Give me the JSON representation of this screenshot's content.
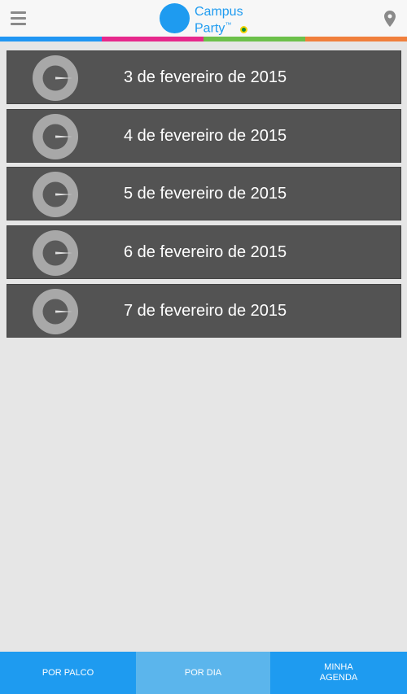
{
  "header": {
    "logo_line1": "Campus",
    "logo_line2": "Party",
    "logo_tm": "™",
    "menu_icon": "hamburger-menu-icon",
    "location_icon": "map-pin-icon"
  },
  "color_bar": [
    "#2196f3",
    "#e6288c",
    "#6cc04a",
    "#f07f3c"
  ],
  "days": [
    {
      "label": "3 de fevereiro de 2015"
    },
    {
      "label": "4 de fevereiro de 2015"
    },
    {
      "label": "5 de fevereiro de 2015"
    },
    {
      "label": "6 de fevereiro de 2015"
    },
    {
      "label": "7 de fevereiro de 2015"
    }
  ],
  "tabs": [
    {
      "label": "POR PALCO"
    },
    {
      "label": "POR DIA",
      "active": true
    },
    {
      "label": "MINHA\nAGENDA"
    }
  ],
  "colors": {
    "accent": "#1e9bf0",
    "active_tab": "#5bb5ec",
    "list_item_bg": "#535353",
    "background": "#e6e6e6"
  }
}
